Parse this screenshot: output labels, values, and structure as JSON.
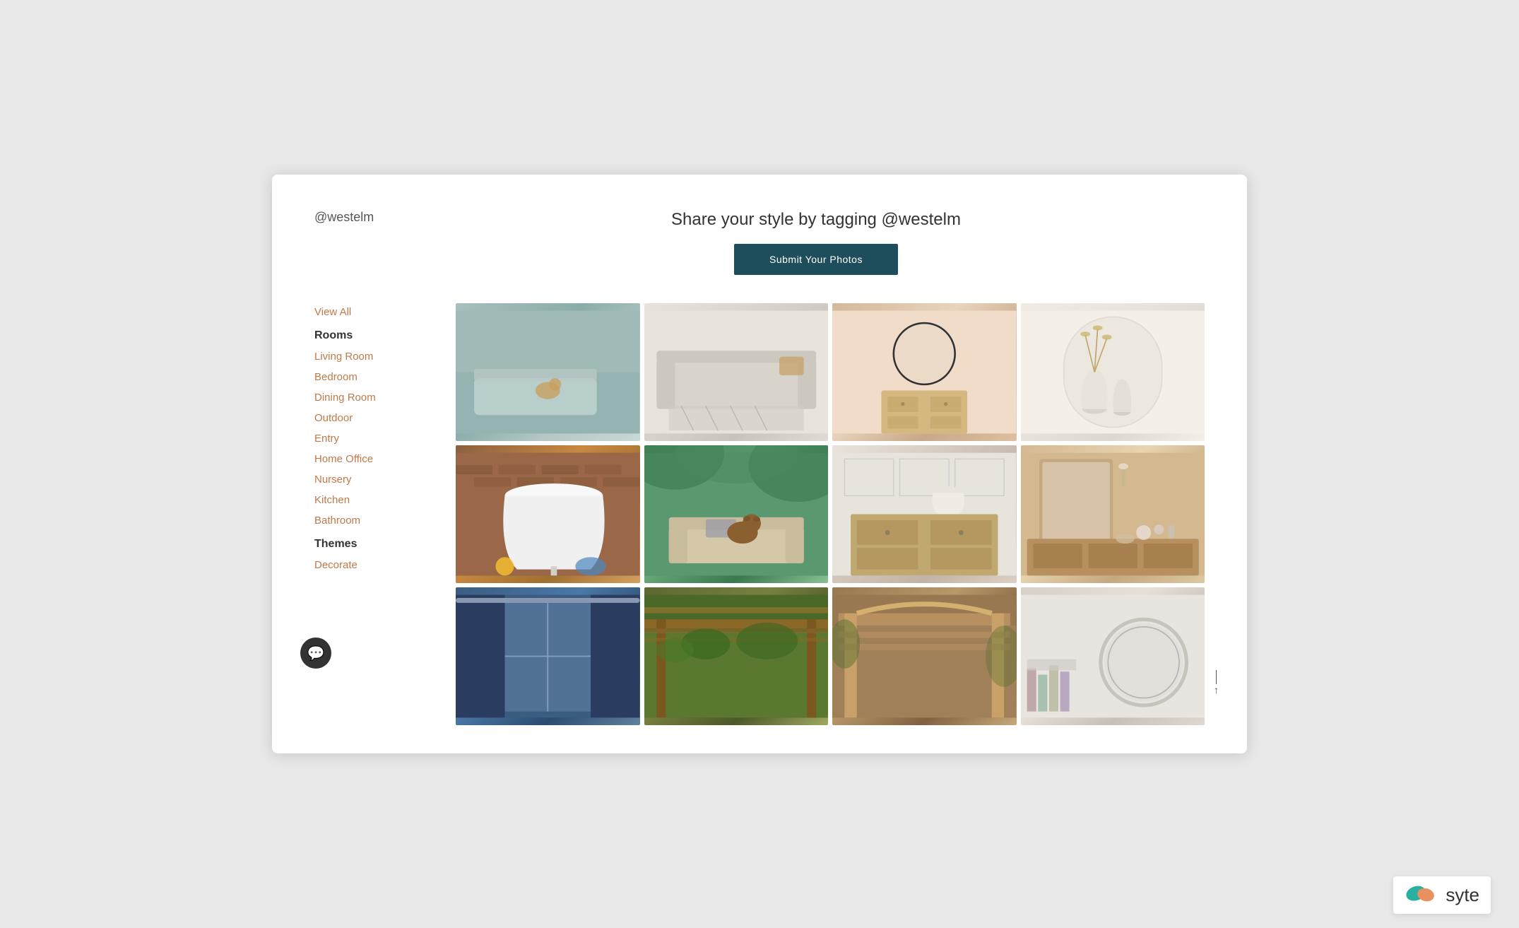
{
  "header": {
    "brand_handle": "@westelm",
    "tagline": "Share your style by tagging @westelm",
    "submit_button_label": "Submit Your Photos"
  },
  "sidebar": {
    "view_all_label": "View All",
    "rooms_heading": "Rooms",
    "themes_heading": "Themes",
    "items": [
      {
        "id": "living-room",
        "label": "Living Room"
      },
      {
        "id": "bedroom",
        "label": "Bedroom"
      },
      {
        "id": "dining-room",
        "label": "Dining Room"
      },
      {
        "id": "outdoor",
        "label": "Outdoor"
      },
      {
        "id": "entry",
        "label": "Entry"
      },
      {
        "id": "home-office",
        "label": "Home Office"
      },
      {
        "id": "nursery",
        "label": "Nursery"
      },
      {
        "id": "kitchen",
        "label": "Kitchen"
      },
      {
        "id": "bathroom",
        "label": "Bathroom"
      },
      {
        "id": "decorate",
        "label": "Decorate"
      }
    ]
  },
  "grid": {
    "photos": [
      {
        "id": "photo-1",
        "alt": "Porch with gray seating and dog",
        "color_class": "p1"
      },
      {
        "id": "photo-2",
        "alt": "White sofa with patterned rug",
        "color_class": "p2"
      },
      {
        "id": "photo-3",
        "alt": "Bathroom with round mirror and dresser",
        "color_class": "p3"
      },
      {
        "id": "photo-4",
        "alt": "White niche with dried plants",
        "color_class": "p4"
      },
      {
        "id": "photo-5",
        "alt": "Lamp on brick background",
        "color_class": "p5"
      },
      {
        "id": "photo-6",
        "alt": "Dog on outdoor bench with greenery",
        "color_class": "p6"
      },
      {
        "id": "photo-7",
        "alt": "Bedroom dresser with lamp",
        "color_class": "p7"
      },
      {
        "id": "photo-8",
        "alt": "Vanity table with mirror",
        "color_class": "p8"
      },
      {
        "id": "photo-9",
        "alt": "Window with dark curtains",
        "color_class": "p9"
      },
      {
        "id": "photo-10",
        "alt": "Outdoor pergola with greenery",
        "color_class": "p10"
      },
      {
        "id": "photo-11",
        "alt": "Wooden pergola structure",
        "color_class": "p11"
      },
      {
        "id": "photo-12",
        "alt": "Round mirror on light wall",
        "color_class": "p12"
      }
    ]
  },
  "syte": {
    "brand_name": "syte"
  },
  "footer": {
    "scroll_top_label": "↑"
  }
}
